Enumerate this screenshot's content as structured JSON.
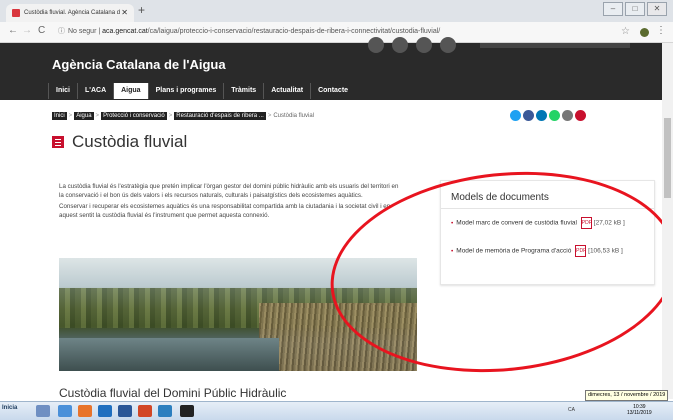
{
  "browser": {
    "tab_title": "Custòdia fluvial. Agència Catalana de",
    "tab_close": "✕",
    "new_tab": "+",
    "back": "←",
    "forward": "→",
    "reload": "C",
    "security": "No segur",
    "url_domain": "aca.gencat.cat",
    "url_path": "/ca/laigua/proteccio-i-conservacio/restauracio-despais-de-ribera-i-connectivitat/custodia-fluvial/",
    "bookmark_icon": "star-icon",
    "menu_icon": "⋮",
    "window_buttons": [
      "–",
      "□",
      "✕"
    ]
  },
  "site": {
    "title": "Agència Catalana de l'Aigua",
    "nav": [
      {
        "label": "Inici",
        "active": false
      },
      {
        "label": "L'ACA",
        "active": false
      },
      {
        "label": "Aigua",
        "active": true
      },
      {
        "label": "Plans i programes",
        "active": false
      },
      {
        "label": "Tràmits",
        "active": false
      },
      {
        "label": "Actualitat",
        "active": false
      },
      {
        "label": "Contacte",
        "active": false
      }
    ]
  },
  "breadcrumb": {
    "items": [
      "Inici",
      "Aigua",
      "Protecció i conservació",
      "Restauració d'espais de ribera ..."
    ],
    "separator": ">",
    "current": "Custòdia fluvial"
  },
  "social": [
    {
      "icon": "twitter-icon",
      "color": "#1da1f2"
    },
    {
      "icon": "facebook-icon",
      "color": "#3b5998"
    },
    {
      "icon": "linkedin-icon",
      "color": "#0077b5"
    },
    {
      "icon": "whatsapp-icon",
      "color": "#25d366"
    },
    {
      "icon": "email-icon",
      "color": "#777777"
    },
    {
      "icon": "print-icon",
      "color": "#c8102e"
    }
  ],
  "page": {
    "title": "Custòdia fluvial",
    "intro_p1": "La custòdia fluvial és l'estratègia que pretén implicar l'òrgan gestor del domini públic hidràulic amb els usuaris del territori en la conservació i el bon ús dels valors i els recursos naturals, culturals i paisatgístics dels ecosistemes aquàtics.",
    "intro_p2": "Conservar i recuperar els ecosistemes aquàtics és una responsabilitat compartida amb la ciutadania i la societat civil i en aquest sentit la custòdia fluvial és l'instrument que permet aquesta connexió.",
    "subheading": "Custòdia fluvial del Domini Públic Hidràulic"
  },
  "documents": {
    "heading": "Models de documents",
    "items": [
      {
        "label": "Model marc de conveni de custòdia fluvial",
        "size": "[27,02 kB ]"
      },
      {
        "label": "Model de memòria de Programa d'acció",
        "size": "[106,53 kB ]"
      }
    ],
    "pdf_icon_label": "PDF"
  },
  "annotation": {
    "color": "#e8141f"
  },
  "tooltip": "dimecres, 13 / novembre / 2019",
  "taskbar": {
    "start_label": "Inicia",
    "tray_lang": "CA",
    "clock_time": "10:39",
    "clock_date": "13/11/2019"
  }
}
